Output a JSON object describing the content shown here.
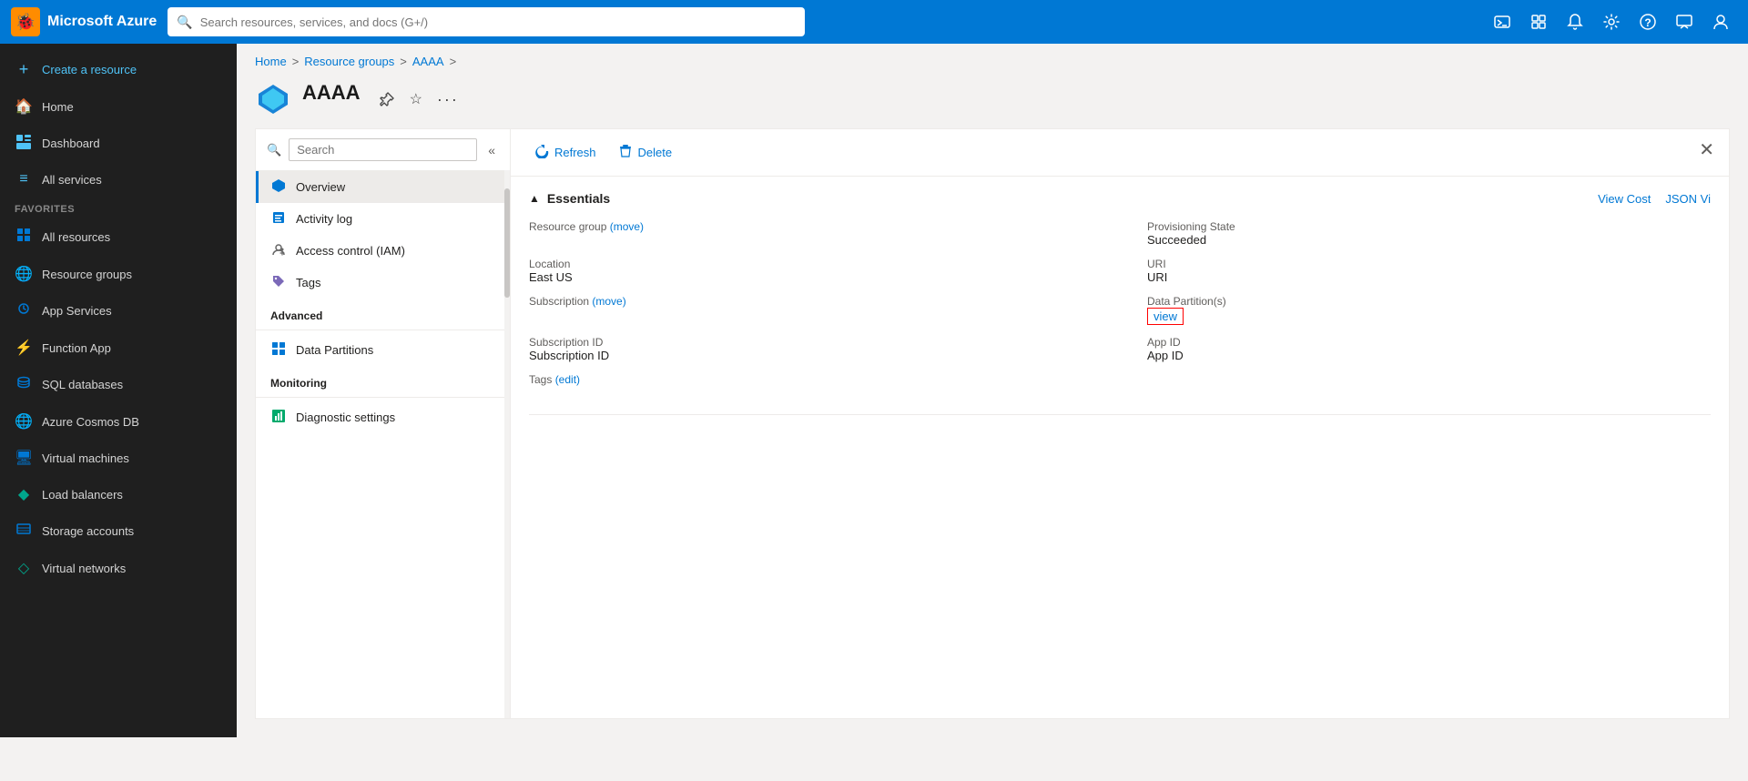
{
  "topNav": {
    "brand": "Microsoft Azure",
    "brandIcon": "🐞",
    "searchPlaceholder": "Search resources, services, and docs (G+/)",
    "navIcons": [
      {
        "name": "cloud-shell-icon",
        "symbol": "⌨",
        "label": "Cloud Shell"
      },
      {
        "name": "portal-settings-icon",
        "symbol": "⊡",
        "label": "Portal Settings"
      },
      {
        "name": "notifications-icon",
        "symbol": "🔔",
        "label": "Notifications"
      },
      {
        "name": "settings-icon",
        "symbol": "⚙",
        "label": "Settings"
      },
      {
        "name": "help-icon",
        "symbol": "?",
        "label": "Help"
      },
      {
        "name": "feedback-icon",
        "symbol": "💬",
        "label": "Feedback"
      }
    ]
  },
  "sidebar": {
    "items": [
      {
        "name": "create-resource",
        "icon": "+",
        "label": "Create a resource",
        "color": "#4fc3f7"
      },
      {
        "name": "home",
        "icon": "🏠",
        "label": "Home"
      },
      {
        "name": "dashboard",
        "icon": "📊",
        "label": "Dashboard"
      },
      {
        "name": "all-services",
        "icon": "≡",
        "label": "All services"
      }
    ],
    "favoritesLabel": "FAVORITES",
    "favorites": [
      {
        "name": "all-resources",
        "icon": "⊞",
        "label": "All resources",
        "iconColor": "#0078d4"
      },
      {
        "name": "resource-groups",
        "icon": "🌐",
        "label": "Resource groups",
        "iconColor": "#0078d4"
      },
      {
        "name": "app-services",
        "icon": "⚡",
        "label": "App Services",
        "iconColor": "#0078d4"
      },
      {
        "name": "function-app",
        "icon": "⚡",
        "label": "Function App",
        "iconColor": "#ffa500"
      },
      {
        "name": "sql-databases",
        "icon": "🗄",
        "label": "SQL databases",
        "iconColor": "#0078d4"
      },
      {
        "name": "azure-cosmos-db",
        "icon": "🌐",
        "label": "Azure Cosmos DB",
        "iconColor": "#0078d4"
      },
      {
        "name": "virtual-machines",
        "icon": "🖥",
        "label": "Virtual machines",
        "iconColor": "#0078d4"
      },
      {
        "name": "load-balancers",
        "icon": "◆",
        "label": "Load balancers",
        "iconColor": "#00a68c"
      },
      {
        "name": "storage-accounts",
        "icon": "≡",
        "label": "Storage accounts",
        "iconColor": "#0078d4"
      },
      {
        "name": "virtual-networks",
        "icon": "◇",
        "label": "Virtual networks",
        "iconColor": "#00a68c"
      }
    ]
  },
  "breadcrumb": {
    "items": [
      "Home",
      "Resource groups",
      "AAAA"
    ],
    "links": [
      "Home",
      "Resource groups"
    ]
  },
  "resource": {
    "name": "AAAA",
    "subtitle": "",
    "iconColor": "#0078d4"
  },
  "resourceHeaderActions": [
    {
      "name": "pin-icon",
      "symbol": "⚡",
      "label": "Pin to dashboard"
    },
    {
      "name": "favorite-icon",
      "symbol": "☆",
      "label": "Favorite"
    },
    {
      "name": "more-icon",
      "symbol": "…",
      "label": "More options"
    }
  ],
  "resourceNav": {
    "searchPlaceholder": "Search",
    "items": [
      {
        "name": "overview",
        "icon": "🔷",
        "label": "Overview",
        "active": true
      },
      {
        "name": "activity-log",
        "icon": "📋",
        "label": "Activity log"
      },
      {
        "name": "access-control",
        "icon": "👤",
        "label": "Access control (IAM)"
      },
      {
        "name": "tags",
        "icon": "🏷",
        "label": "Tags"
      }
    ],
    "sections": [
      {
        "label": "Advanced",
        "items": [
          {
            "name": "data-partitions",
            "icon": "⊞",
            "label": "Data Partitions"
          }
        ]
      },
      {
        "label": "Monitoring",
        "items": [
          {
            "name": "diagnostic-settings",
            "icon": "📊",
            "label": "Diagnostic settings"
          }
        ]
      }
    ]
  },
  "toolbar": {
    "refreshLabel": "Refresh",
    "deleteLabel": "Delete"
  },
  "essentials": {
    "title": "Essentials",
    "viewCostLabel": "View Cost",
    "jsonViewLabel": "JSON Vi",
    "fields": [
      {
        "label": "Resource group",
        "value": "",
        "link": "move",
        "linkText": "(move)",
        "col": 0
      },
      {
        "label": "Provisioning State",
        "value": "Succeeded",
        "col": 1
      },
      {
        "label": "Location",
        "value": "East US",
        "col": 0
      },
      {
        "label": "URI",
        "value": "URI",
        "col": 1
      },
      {
        "label": "Subscription",
        "value": "",
        "link": "move",
        "linkText": "(move)",
        "col": 0
      },
      {
        "label": "Data Partition(s)",
        "value": "",
        "viewLink": "view",
        "col": 1
      },
      {
        "label": "Subscription ID",
        "value": "Subscription ID",
        "col": 0
      },
      {
        "label": "App ID",
        "value": "App ID",
        "col": 1
      },
      {
        "label": "Tags",
        "value": "",
        "editLink": "edit",
        "editText": "(edit)",
        "col": 0
      }
    ]
  }
}
